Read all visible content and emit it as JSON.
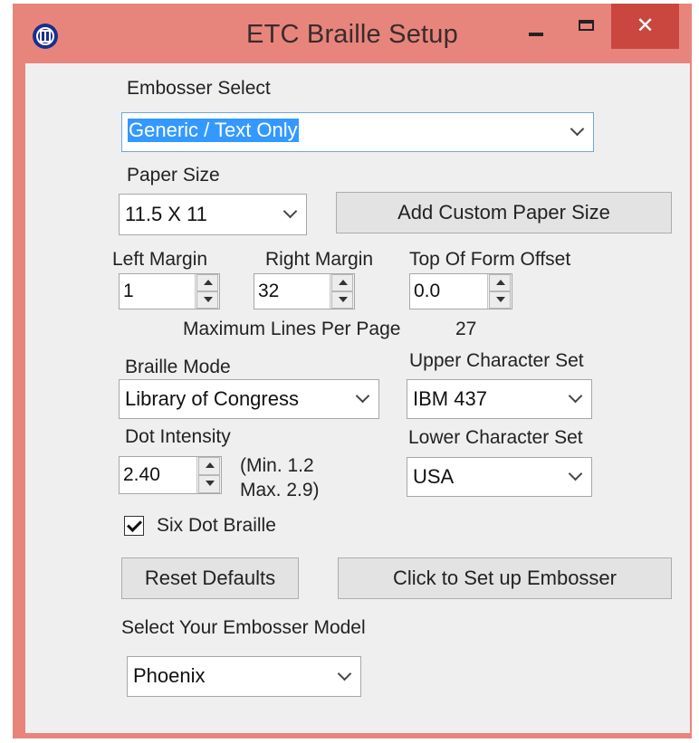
{
  "window": {
    "title": "ETC Braille Setup",
    "close_glyph": "✕",
    "accent_color": "#e7857d",
    "close_color": "#c9473f"
  },
  "embosser_select": {
    "label": "Embosser Select",
    "value": "Generic / Text Only"
  },
  "paper_size": {
    "label": "Paper Size",
    "value": "11.5 X 11",
    "add_custom_label": "Add Custom Paper Size"
  },
  "margins": {
    "left": {
      "label": "Left Margin",
      "value": "1"
    },
    "right": {
      "label": "Right Margin",
      "value": "32"
    },
    "top_of_form": {
      "label": "Top Of Form Offset",
      "value": "0.0"
    }
  },
  "max_lines": {
    "label": "Maximum Lines Per Page",
    "value": "27"
  },
  "braille_mode": {
    "label": "Braille Mode",
    "value": "Library of Congress"
  },
  "upper_charset": {
    "label": "Upper Character Set",
    "value": "IBM 437"
  },
  "dot_intensity": {
    "label": "Dot Intensity",
    "value": "2.40",
    "min_note": "(Min. 1.2",
    "max_note": "Max. 2.9)"
  },
  "lower_charset": {
    "label": "Lower Character Set",
    "value": "USA"
  },
  "six_dot": {
    "label": "Six Dot Braille",
    "checked": true
  },
  "buttons": {
    "reset": "Reset Defaults",
    "setup": "Click to Set up Embosser"
  },
  "model": {
    "label": "Select Your Embosser Model",
    "value": "Phoenix"
  },
  "icons": [
    "app-logo-icon",
    "minimize-icon",
    "maximize-icon",
    "close-icon",
    "chevron-down-icon",
    "spinner-up-icon",
    "spinner-down-icon",
    "checkmark-icon"
  ]
}
